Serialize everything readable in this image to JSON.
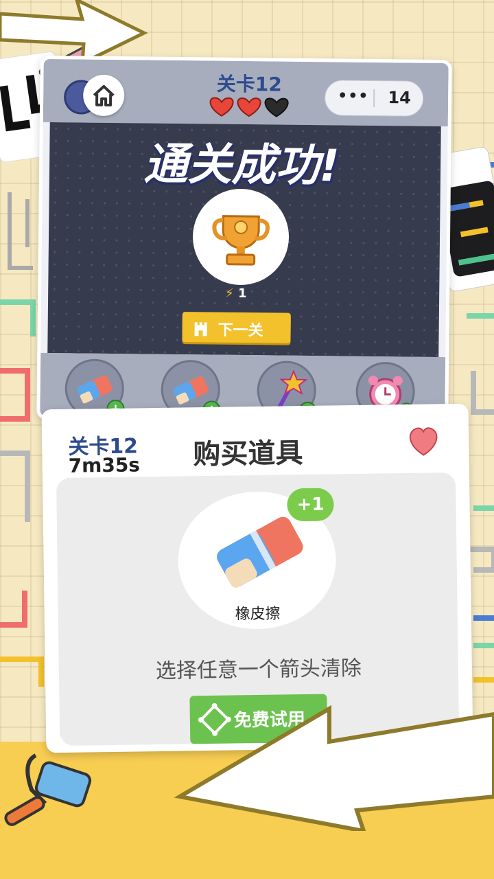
{
  "game": {
    "level_label": "关卡12",
    "hearts": {
      "full": 2,
      "total": 3
    },
    "moves_count": "14",
    "menu_dots": "•••",
    "success_text": "通关成功!",
    "energy_value": "1",
    "next_level_label": "下一关",
    "tools": [
      {
        "name": "eraser-tool"
      },
      {
        "name": "eraser-tool"
      },
      {
        "name": "magic-wand-tool"
      },
      {
        "name": "alarm-clock-tool"
      }
    ]
  },
  "dialog": {
    "level_label": "关卡12",
    "timer": "7m35s",
    "title": "购买道具",
    "item_name": "橡皮擦",
    "item_badge": "+1",
    "description": "选择任意一个箭头清除",
    "try_button_label": "免费试用"
  },
  "colors": {
    "level_blue": "#2d4b8e",
    "button_yellow": "#f2c12c",
    "button_green": "#6cc24f",
    "heart_red": "#e8463a",
    "board_dark": "#363b4e"
  }
}
